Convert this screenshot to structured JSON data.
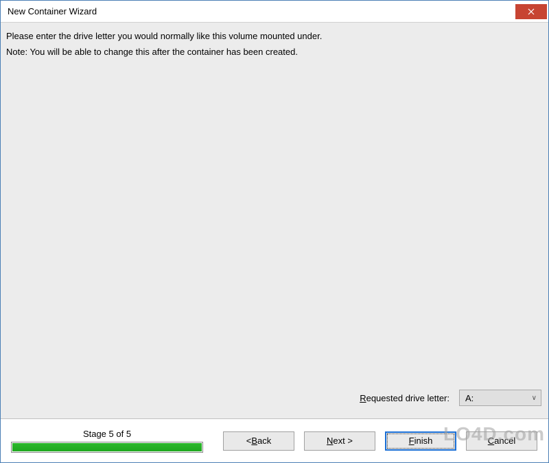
{
  "window": {
    "title": "New Container Wizard"
  },
  "content": {
    "line1": "Please enter the drive letter you would normally like this volume mounted under.",
    "line2": "Note: You will be able to change this after the container has been created.",
    "drive_label_pre": "R",
    "drive_label_post": "equested drive letter:",
    "drive_value": "A:"
  },
  "footer": {
    "stage_label": "Stage 5 of 5",
    "progress_percent": 100,
    "back_pre": "< ",
    "back_ul": "B",
    "back_post": "ack",
    "next_ul": "N",
    "next_post": "ext >",
    "finish_ul": "F",
    "finish_post": "inish",
    "cancel_ul": "C",
    "cancel_post": "ancel"
  },
  "watermark": "LO4D.com"
}
